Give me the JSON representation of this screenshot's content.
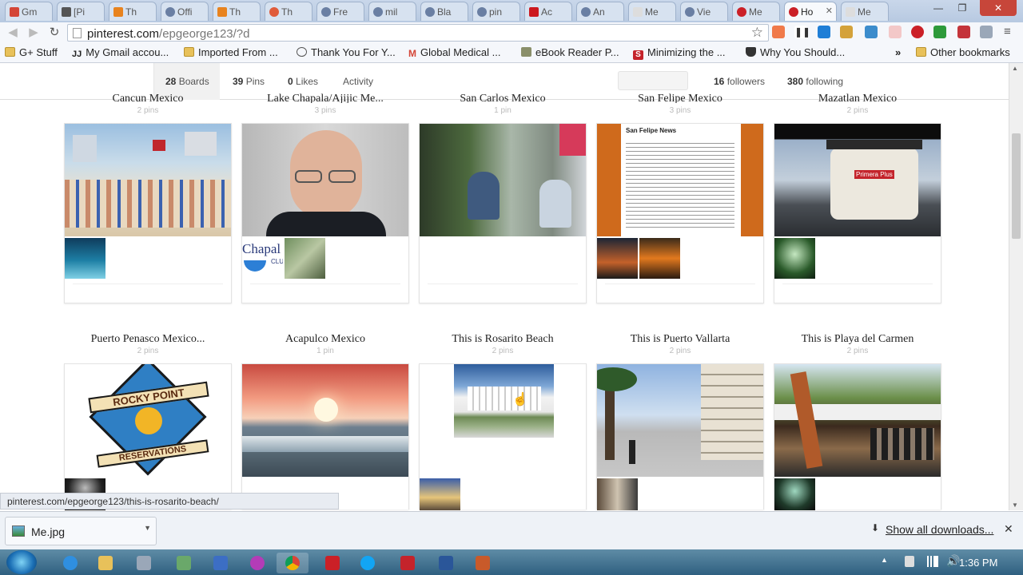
{
  "browser": {
    "tabs": [
      {
        "label": "Gm",
        "color": "#d44638"
      },
      {
        "label": "[Pi",
        "color": "#555555"
      },
      {
        "label": "Th",
        "color": "#e8831e"
      },
      {
        "label": "Offi",
        "color": "#6a7fa3"
      },
      {
        "label": "Th",
        "color": "#e8831e"
      },
      {
        "label": "Th",
        "color": "#e05b3a"
      },
      {
        "label": "Fre",
        "color": "#6a7fa3"
      },
      {
        "label": "mil",
        "color": "#6a7fa3"
      },
      {
        "label": "Bla",
        "color": "#6a7fa3"
      },
      {
        "label": "pin",
        "color": "#6a7fa3"
      },
      {
        "label": "Ac",
        "color": "#cc181e"
      },
      {
        "label": "An",
        "color": "#6a7fa3"
      },
      {
        "label": "Me",
        "color": "#dddddd"
      },
      {
        "label": "Vie",
        "color": "#6a7fa3"
      },
      {
        "label": "Me",
        "color": "#cb2027"
      },
      {
        "label": "Ho",
        "color": "#cb2027"
      },
      {
        "label": "Me",
        "color": "#dddddd"
      }
    ],
    "url_host": "pinterest.com",
    "url_path": "/epgeorge123/?d",
    "bookmarks": [
      {
        "label": "G+ Stuff",
        "icon": "folder-icon"
      },
      {
        "label": "My Gmail accou...",
        "icon": "jj-icon"
      },
      {
        "label": "Imported From ...",
        "icon": "folder-icon"
      },
      {
        "label": "Thank You For Y...",
        "icon": "globe-icon"
      },
      {
        "label": "Global Medical ...",
        "icon": "gmail-icon"
      },
      {
        "label": "eBook Reader P...",
        "icon": "puzzle-icon"
      },
      {
        "label": "Minimizing the ...",
        "icon": "s-icon"
      },
      {
        "label": "Why You Should...",
        "icon": "grad-cap-icon"
      }
    ],
    "other_bookmarks": "Other bookmarks",
    "chevron": "»"
  },
  "profile_nav": {
    "boards_count": "28",
    "boards_label": "Boards",
    "pins_count": "39",
    "pins_label": "Pins",
    "likes_count": "0",
    "likes_label": "Likes",
    "activity_label": "Activity",
    "followers_count": "16",
    "followers_label": "followers",
    "following_count": "380",
    "following_label": "following"
  },
  "boards_row1": [
    {
      "title": "Cancun Mexico",
      "count": "2 pins"
    },
    {
      "title": "Lake Chapala/Ajijic Me...",
      "count": "3 pins"
    },
    {
      "title": "San Carlos Mexico",
      "count": "1 pin"
    },
    {
      "title": "San Felipe Mexico",
      "count": "3 pins"
    },
    {
      "title": "Mazatlan Mexico",
      "count": "2 pins"
    }
  ],
  "boards_row2": [
    {
      "title": "Puerto Penasco Mexico...",
      "count": "2 pins"
    },
    {
      "title": "Acapulco Mexico",
      "count": "1 pin"
    },
    {
      "title": "This is Rosarito Beach",
      "count": "2 pins"
    },
    {
      "title": "This is Puerto Vallarta",
      "count": "2 pins"
    },
    {
      "title": "This is Playa del Carmen",
      "count": "2 pins"
    }
  ],
  "images": {
    "rocky_point_line1": "ROCKY POINT",
    "rocky_point_line2": "RESERVATIONS",
    "chapala_text": "Chapal",
    "chapala_sub": "CLUB",
    "san_felipe_news": "San Felipe News",
    "primera_plus": "Primera Plus"
  },
  "status_url": "pinterest.com/epgeorge123/this-is-rosarito-beach/",
  "downloads": {
    "file": "Me.jpg",
    "show_all": "Show all downloads..."
  },
  "taskbar": {
    "time": "1:36 PM"
  }
}
